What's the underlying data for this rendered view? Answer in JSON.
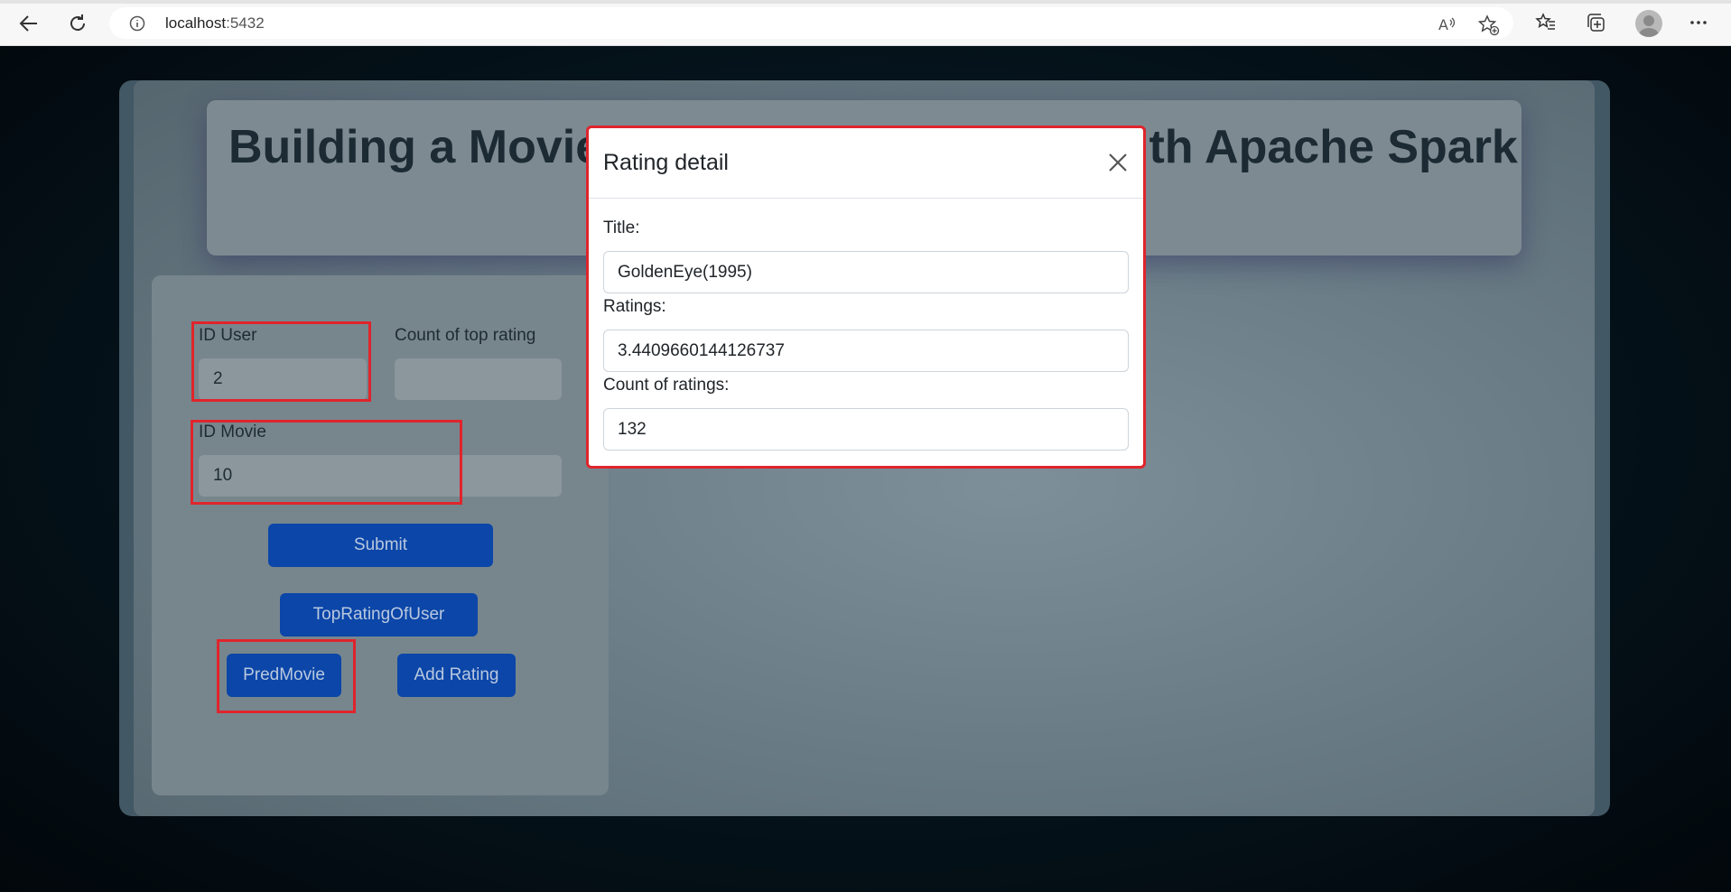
{
  "browser": {
    "url_host": "localhost",
    "url_port": ":5432"
  },
  "header": {
    "title_left": "Building a Movie",
    "title_right": "ith Apache Spark"
  },
  "form": {
    "id_user_label": "ID User",
    "id_user_value": "2",
    "count_top_label": "Count of top rating",
    "count_top_value": "",
    "id_movie_label": "ID Movie",
    "id_movie_value": "10",
    "submit_label": "Submit",
    "top_rating_label": "TopRatingOfUser",
    "pred_movie_label": "PredMovie",
    "add_rating_label": "Add Rating"
  },
  "modal": {
    "title": "Rating detail",
    "fields": [
      {
        "label": "Title:",
        "value": "GoldenEye(1995)"
      },
      {
        "label": "Ratings:",
        "value": "3.4409660144126737"
      },
      {
        "label": "Count of ratings:",
        "value": "132"
      }
    ]
  },
  "colors": {
    "highlight": "#e0242c",
    "button": "#0b46a8"
  }
}
